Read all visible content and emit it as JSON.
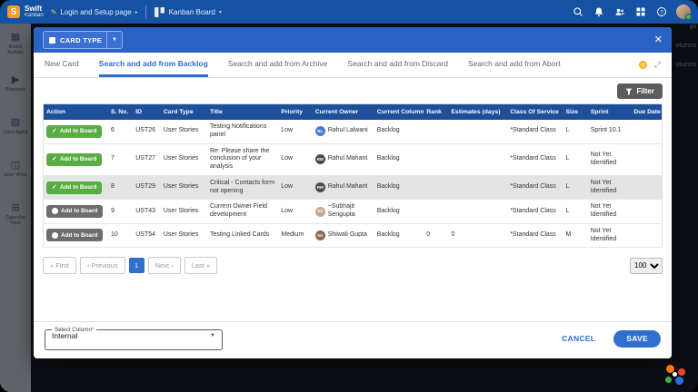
{
  "topnav": {
    "brand_line1": "Swift",
    "brand_line2": "Kanban",
    "breadcrumb": "Login and Setup page",
    "board_menu": "Kanban Board"
  },
  "background": {
    "fragments": [
      "gs",
      "olumns",
      "olumns"
    ]
  },
  "sidebar": {
    "items": [
      {
        "label": "Board Activity",
        "icon": "board-activity-icon"
      },
      {
        "label": "Playback",
        "icon": "playback-icon"
      },
      {
        "label": "Card Aging",
        "icon": "card-aging-icon"
      },
      {
        "label": "User Wise",
        "icon": "user-wise-icon"
      },
      {
        "label": "Calendar View",
        "icon": "calendar-view-icon"
      }
    ]
  },
  "modal": {
    "title": "CARD TYPE",
    "tabs": [
      {
        "label": "New Card",
        "active": false
      },
      {
        "label": "Search and add from Backlog",
        "active": true
      },
      {
        "label": "Search and add from Archive",
        "active": false
      },
      {
        "label": "Search and add from Discard",
        "active": false
      },
      {
        "label": "Search and add from Abort",
        "active": false
      }
    ],
    "filter_label": "Filter",
    "table": {
      "columns": [
        "Action",
        "S. No.",
        "ID",
        "Card Type",
        "Title",
        "Priority",
        "Current Owner",
        "Current Column",
        "Rank",
        "Estimates (days)",
        "Class Of Service",
        "Size",
        "Sprint",
        "Due Date"
      ],
      "rows": [
        {
          "action": "Add to Board",
          "added": true,
          "selected": false,
          "sno": "6",
          "id": "UST26",
          "card_type": "User Stories",
          "title": "Testing Notifications panel",
          "priority": "Low",
          "owner": "Rahul Lalwani",
          "owner_initials": "RL",
          "avatar_color": "#4a7bd0",
          "column": "Backlog",
          "rank": "",
          "estimates": "",
          "cos": "*Standard Class",
          "size": "L",
          "sprint": "Sprint 10.1",
          "due": ""
        },
        {
          "action": "Add to Board",
          "added": true,
          "selected": false,
          "sno": "7",
          "id": "UST27",
          "card_type": "User Stories",
          "title": "Re: Please share the conclusion of your analysis",
          "priority": "Low",
          "owner": "Rahul Mahant",
          "owner_initials": "RM",
          "avatar_color": "#454b57",
          "column": "Backlog",
          "rank": "",
          "estimates": "",
          "cos": "*Standard Class",
          "size": "L",
          "sprint": "Not Yet Identified",
          "due": ""
        },
        {
          "action": "Add to Board",
          "added": true,
          "selected": true,
          "sno": "8",
          "id": "UST29",
          "card_type": "User Stories",
          "title": "Critical - Contacts form not opening",
          "priority": "Low",
          "owner": "Rahul Mahant",
          "owner_initials": "RM",
          "avatar_color": "#454b57",
          "column": "Backlog",
          "rank": "",
          "estimates": "",
          "cos": "*Standard Class",
          "size": "L",
          "sprint": "Not Yet Identified",
          "due": ""
        },
        {
          "action": "Add to Board",
          "added": false,
          "selected": false,
          "sno": "9",
          "id": "UST43",
          "card_type": "User Stories",
          "title": "Current Owner Field development",
          "priority": "Low",
          "owner": "~Subhajit Sengupta",
          "owner_initials": "SS",
          "avatar_color": "#c2a98f",
          "column": "Backlog",
          "rank": "",
          "estimates": "",
          "cos": "*Standard Class",
          "size": "L",
          "sprint": "Not Yet Identified",
          "due": ""
        },
        {
          "action": "Add to Board",
          "added": false,
          "selected": false,
          "sno": "10",
          "id": "UST54",
          "card_type": "User Stories",
          "title": "Testing Linked Cards",
          "priority": "Medium",
          "owner": "Shiwali Gupta",
          "owner_initials": "SG",
          "avatar_color": "#8a6a52",
          "column": "Backlog",
          "rank": "0",
          "estimates": "0",
          "cos": "*Standard Class",
          "size": "M",
          "sprint": "Not Yet Identified",
          "due": ""
        }
      ]
    },
    "pagination": {
      "first": "« First",
      "previous": "‹ Previous",
      "current": "1",
      "next": "Next ›",
      "last": "Last »",
      "page_size": "100"
    },
    "footer": {
      "select_label": "Select Column",
      "required_mark": "*",
      "select_value": "Internal",
      "cancel_label": "CANCEL",
      "save_label": "SAVE"
    }
  }
}
